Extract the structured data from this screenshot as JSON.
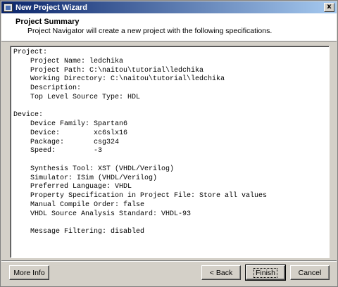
{
  "window": {
    "title": "New Project Wizard",
    "close_label": "x"
  },
  "header": {
    "title": "Project Summary",
    "subtitle": "Project Navigator will create a new project with the following specifications."
  },
  "summary": {
    "lines": [
      "Project:",
      "    Project Name: ledchika",
      "    Project Path: C:\\naitou\\tutorial\\ledchika",
      "    Working Directory: C:\\naitou\\tutorial\\ledchika",
      "    Description:",
      "    Top Level Source Type: HDL",
      "",
      "Device:",
      "    Device Family: Spartan6",
      "    Device:        xc6slx16",
      "    Package:       csg324",
      "    Speed:         -3",
      "",
      "    Synthesis Tool: XST (VHDL/Verilog)",
      "    Simulator: ISim (VHDL/Verilog)",
      "    Preferred Language: VHDL",
      "    Property Specification in Project File: Store all values",
      "    Manual Compile Order: false",
      "    VHDL Source Analysis Standard: VHDL-93",
      "",
      "    Message Filtering: disabled"
    ]
  },
  "buttons": {
    "more_info": "More Info",
    "back": "< Back",
    "finish": "Finish",
    "cancel": "Cancel"
  }
}
